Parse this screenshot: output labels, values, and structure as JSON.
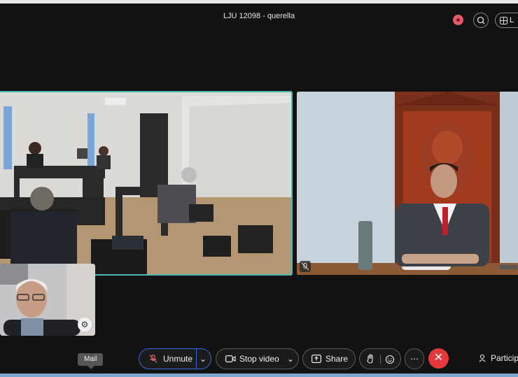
{
  "window": {
    "title": "LJU 12098 - querella"
  },
  "header": {
    "record_icon": "record-icon",
    "zoom_icon": "zoom-icon",
    "layout_label": "L",
    "layout_icon": "grid-layout-icon"
  },
  "tooltip": {
    "label": "Mail"
  },
  "toolbar": {
    "unmute_label": "Unmute",
    "stop_video_label": "Stop video",
    "share_label": "Share",
    "participants_label": "Particip",
    "icons": [
      "mic-muted-icon",
      "chevron-down-icon",
      "video-camera-icon",
      "share-screen-icon",
      "raise-hand-icon",
      "reactions-icon",
      "more-icon",
      "close-icon",
      "participants-icon"
    ]
  },
  "colors": {
    "background": "#121212",
    "active_speaker_border": "#4ab8b0",
    "unmute_border": "#3b66d6",
    "end_call": "#e4393c",
    "recording": "#e35b6a"
  }
}
